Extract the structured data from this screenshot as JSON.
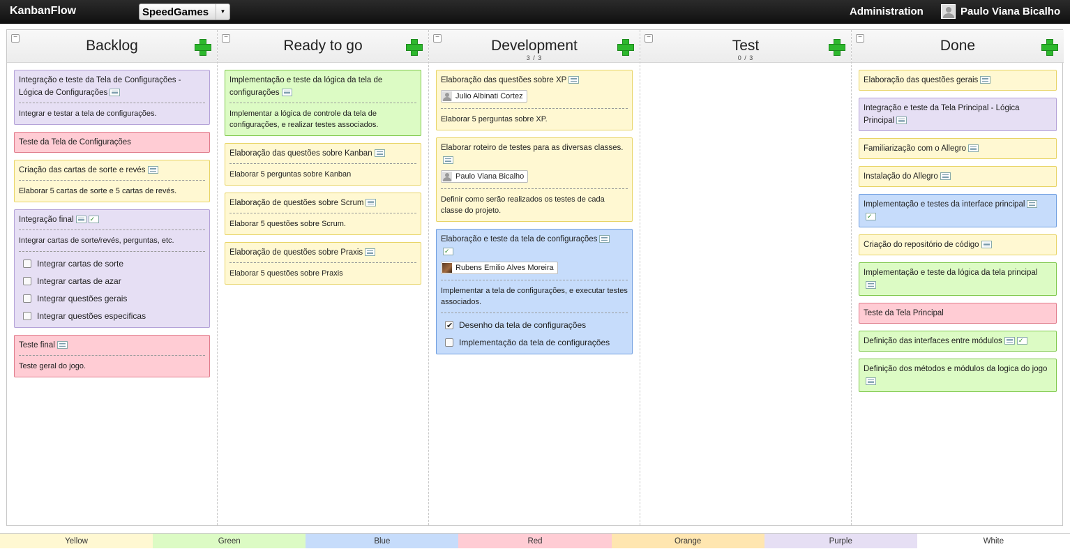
{
  "app": {
    "title": "KanbanFlow"
  },
  "board_select": {
    "value": "SpeedGames"
  },
  "header": {
    "admin": "Administration",
    "user_name": "Paulo Viana Bicalho"
  },
  "columns": [
    {
      "title": "Backlog",
      "wip": "",
      "cards": [
        {
          "color": "purple",
          "title": "Integração e teste da Tela de Configurações - Lógica de Configurações",
          "note": true,
          "desc": "Integrar e testar a tela de configurações."
        },
        {
          "color": "red",
          "title": "Teste da Tela de Configurações"
        },
        {
          "color": "yellow",
          "title": "Criação das cartas de sorte e revés",
          "note": true,
          "desc": "Elaborar 5 cartas de sorte e 5 cartas de revés."
        },
        {
          "color": "purple",
          "title": "Integração final",
          "note": true,
          "checklist": true,
          "desc": "Integrar cartas de sorte/revés, perguntas, etc.",
          "subtasks": [
            {
              "label": "Integrar cartas de sorte",
              "done": false
            },
            {
              "label": "Integrar cartas de azar",
              "done": false
            },
            {
              "label": "Integrar questões gerais",
              "done": false
            },
            {
              "label": "Integrar questões especificas",
              "done": false
            }
          ]
        },
        {
          "color": "red",
          "title": "Teste final",
          "note": true,
          "desc": "Teste geral do jogo."
        }
      ]
    },
    {
      "title": "Ready to go",
      "wip": "",
      "cards": [
        {
          "color": "green",
          "title": "Implementação e teste da lógica da tela de configurações",
          "note": true,
          "desc": "Implementar a lógica de controle da tela de configurações, e realizar testes associados."
        },
        {
          "color": "yellow",
          "title": "Elaboração das questões sobre Kanban",
          "note": true,
          "desc": "Elaborar 5 perguntas sobre Kanban"
        },
        {
          "color": "yellow",
          "title": "Elaboração de questões sobre Scrum",
          "note": true,
          "desc": "Elaborar 5 questões sobre Scrum."
        },
        {
          "color": "yellow",
          "title": "Elaboração de questões sobre Praxis",
          "note": true,
          "desc": "Elaborar 5 questões sobre Praxis"
        }
      ]
    },
    {
      "title": "Development",
      "wip": "3 / 3",
      "cards": [
        {
          "color": "yellow",
          "title": "Elaboração das questões sobre XP",
          "note": true,
          "user": "Julio Albinati Cortez",
          "desc": "Elaborar 5 perguntas sobre XP."
        },
        {
          "color": "yellow",
          "title": "Elaborar roteiro de testes para as diversas classes.",
          "note": true,
          "user": "Paulo Viana Bicalho",
          "desc": "Definir como serão realizados os testes de cada classe do projeto."
        },
        {
          "color": "blue",
          "title": "Elaboração e teste da tela de configurações",
          "note": true,
          "checklist_newline": true,
          "user": "Rubens Emilio Alves Moreira",
          "user_photo": true,
          "desc": "Implementar a tela de configurações, e executar testes associados.",
          "subtasks": [
            {
              "label": "Desenho da tela de configurações",
              "done": true
            },
            {
              "label": "Implementação da tela de configurações",
              "done": false
            }
          ]
        }
      ]
    },
    {
      "title": "Test",
      "wip": "0 / 3",
      "cards": []
    },
    {
      "title": "Done",
      "wip": "",
      "cards": [
        {
          "color": "yellow",
          "title": "Elaboração das questões gerais",
          "note": true
        },
        {
          "color": "purple",
          "title": "Integração e teste da Tela Principal - Lógica Principal",
          "note": true
        },
        {
          "color": "yellow",
          "title": "Familiarização com o Allegro",
          "note": true
        },
        {
          "color": "yellow",
          "title": "Instalação do Allegro",
          "note": true
        },
        {
          "color": "blue",
          "title": "Implementação e testes da interface principal",
          "note": true,
          "checklist_newline": true
        },
        {
          "color": "yellow",
          "title": "Criação do repositório de código",
          "note": true
        },
        {
          "color": "green",
          "title": "Implementação e teste da lógica da tela principal",
          "note_newline": true
        },
        {
          "color": "red",
          "title": "Teste da Tela Principal"
        },
        {
          "color": "green",
          "title": "Definição das interfaces entre módulos",
          "note": true,
          "checklist": true
        },
        {
          "color": "green",
          "title": "Definição dos métodos e módulos da logica do jogo",
          "note": true
        }
      ]
    }
  ],
  "legend": [
    {
      "label": "Yellow",
      "color": "#fff8d2"
    },
    {
      "label": "Green",
      "color": "#dcfbc4"
    },
    {
      "label": "Blue",
      "color": "#c6dcfb"
    },
    {
      "label": "Red",
      "color": "#ffccd4"
    },
    {
      "label": "Orange",
      "color": "#ffe6b0"
    },
    {
      "label": "Purple",
      "color": "#e6dff4"
    },
    {
      "label": "White",
      "color": "#ffffff"
    }
  ]
}
